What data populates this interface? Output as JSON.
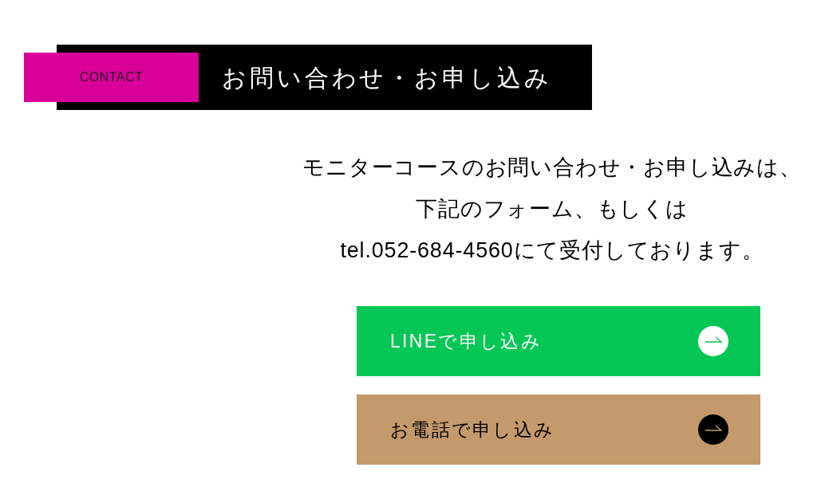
{
  "heading": {
    "label": "CONTACT",
    "title": "お問い合わせ・お申し込み"
  },
  "intro": [
    "モニターコースのお問い合わせ・お申し込みは、",
    "下記のフォーム、もしくは",
    "tel.052-684-4560にて受付しております。"
  ],
  "buttons": [
    {
      "kind": "line",
      "label": "LINEで申し込み"
    },
    {
      "kind": "phone",
      "label": "お電話で申し込み"
    }
  ]
}
